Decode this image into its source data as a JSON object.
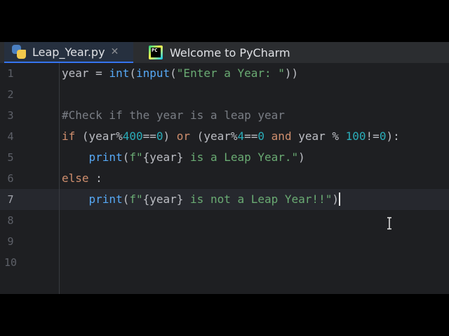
{
  "tabs": [
    {
      "label": "Leap_Year.py",
      "active": true
    },
    {
      "label": "Welcome to PyCharm",
      "active": false
    }
  ],
  "tab_close_glyph": "✕",
  "editor": {
    "current_line": 7,
    "line_numbers": [
      "1",
      "2",
      "3",
      "4",
      "5",
      "6",
      "7",
      "8",
      "9",
      "10"
    ],
    "lines": [
      [
        {
          "t": "year = ",
          "c": "plain"
        },
        {
          "t": "int",
          "c": "builtin"
        },
        {
          "t": "(",
          "c": "plain"
        },
        {
          "t": "input",
          "c": "builtin"
        },
        {
          "t": "(",
          "c": "plain"
        },
        {
          "t": "\"Enter a Year: \"",
          "c": "string"
        },
        {
          "t": "))",
          "c": "plain"
        }
      ],
      [],
      [
        {
          "t": "#Check if the year is a leap year",
          "c": "comment"
        }
      ],
      [
        {
          "t": "if",
          "c": "keyword"
        },
        {
          "t": " (year%",
          "c": "plain"
        },
        {
          "t": "400",
          "c": "number"
        },
        {
          "t": "==",
          "c": "plain"
        },
        {
          "t": "0",
          "c": "number"
        },
        {
          "t": ") ",
          "c": "plain"
        },
        {
          "t": "or",
          "c": "keyword"
        },
        {
          "t": " (year%",
          "c": "plain"
        },
        {
          "t": "4",
          "c": "number"
        },
        {
          "t": "==",
          "c": "plain"
        },
        {
          "t": "0",
          "c": "number"
        },
        {
          "t": " ",
          "c": "plain"
        },
        {
          "t": "and",
          "c": "keyword"
        },
        {
          "t": " year % ",
          "c": "plain"
        },
        {
          "t": "100",
          "c": "number"
        },
        {
          "t": "!=",
          "c": "plain"
        },
        {
          "t": "0",
          "c": "number"
        },
        {
          "t": "):",
          "c": "plain"
        }
      ],
      [
        {
          "t": "    ",
          "c": "plain"
        },
        {
          "t": "print",
          "c": "builtin"
        },
        {
          "t": "(",
          "c": "plain"
        },
        {
          "t": "f\"",
          "c": "string"
        },
        {
          "t": "{year}",
          "c": "plain"
        },
        {
          "t": " is a Leap Year.\"",
          "c": "string"
        },
        {
          "t": ")",
          "c": "plain"
        }
      ],
      [
        {
          "t": "else",
          "c": "keyword"
        },
        {
          "t": " :",
          "c": "plain"
        }
      ],
      [
        {
          "t": "    ",
          "c": "plain"
        },
        {
          "t": "print",
          "c": "builtin"
        },
        {
          "t": "(",
          "c": "plain"
        },
        {
          "t": "f\"",
          "c": "string"
        },
        {
          "t": "{year}",
          "c": "plain"
        },
        {
          "t": " is not a Leap Year!!\"",
          "c": "string"
        },
        {
          "t": ")",
          "c": "plain"
        }
      ],
      [],
      [],
      []
    ]
  },
  "colors": {
    "background": "#1e1f22",
    "keyword": "#cf8e6d",
    "builtin": "#8888c6",
    "string": "#6aab73",
    "number": "#2aacb8",
    "comment": "#7a7e85",
    "plain": "#bcbec4",
    "tab_accent": "#3574f0"
  },
  "icons": {
    "tab1": "python-file-icon",
    "tab2": "pycharm-logo-icon",
    "close": "close-icon",
    "cursor": "text-cursor-icon"
  }
}
